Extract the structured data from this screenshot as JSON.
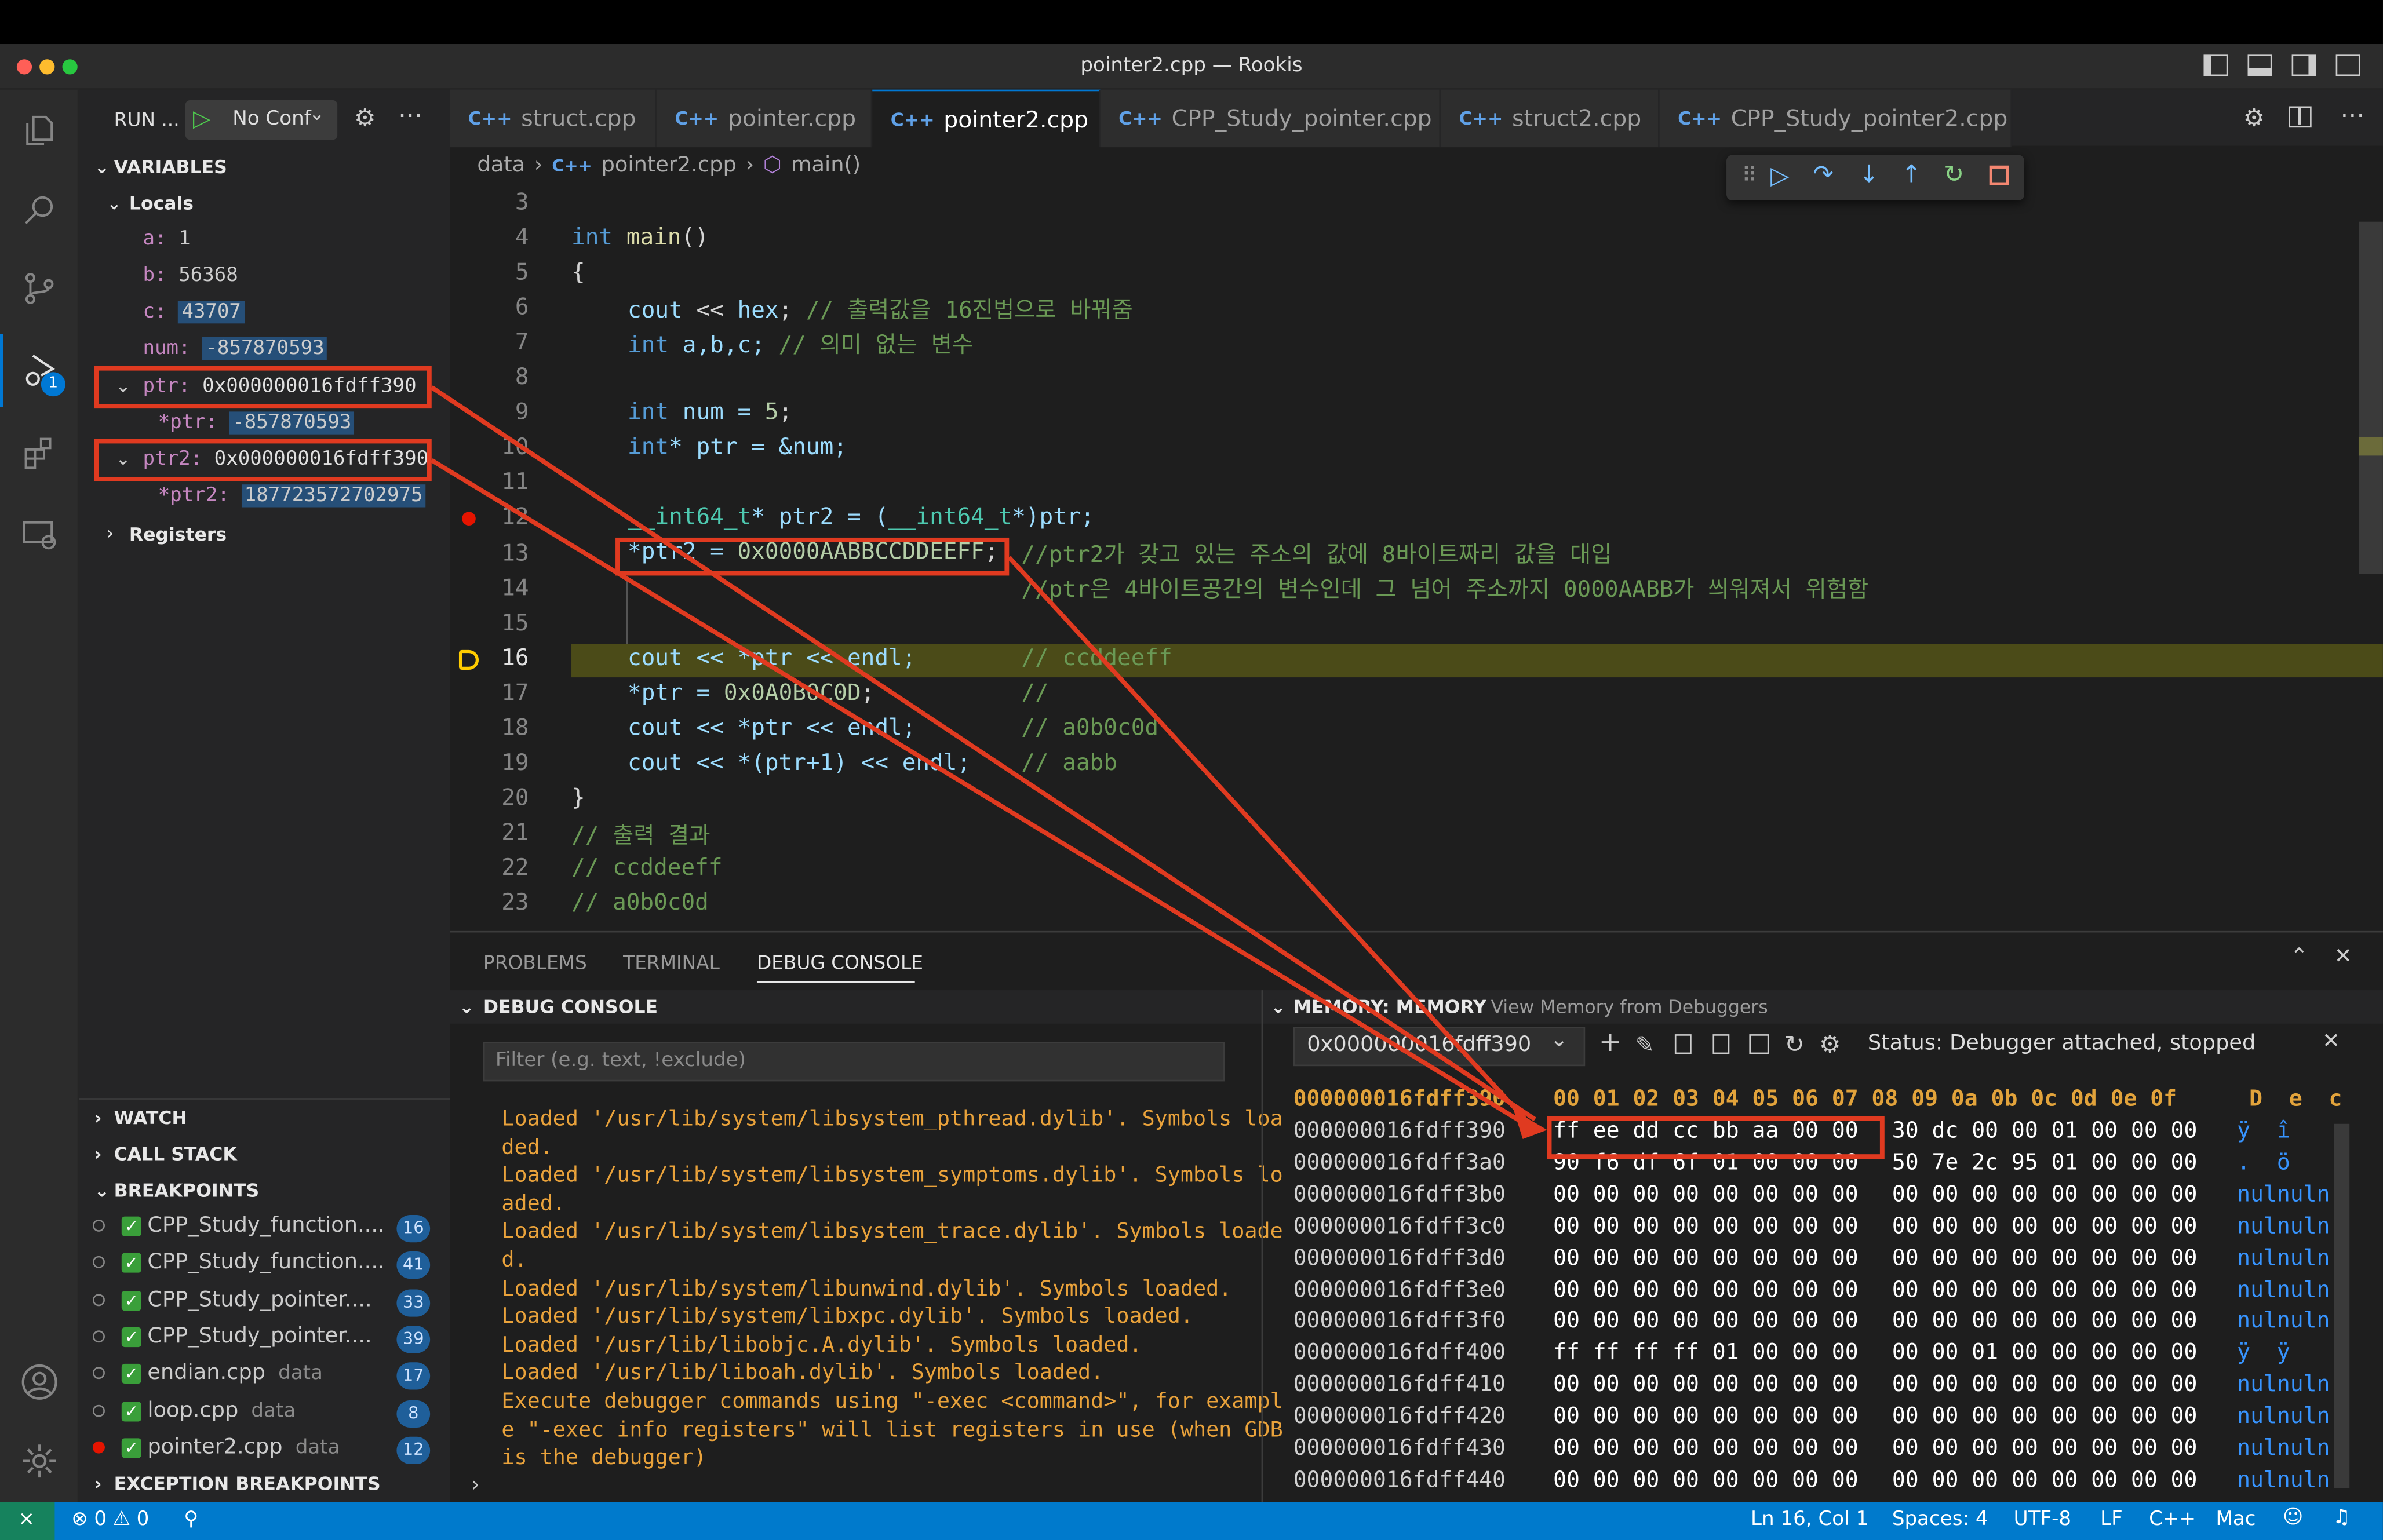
{
  "window": {
    "title": "pointer2.cpp — Rookis"
  },
  "run": {
    "label": "RUN ...",
    "config": "No Conf"
  },
  "variables": {
    "header": "VARIABLES",
    "locals": "Locals",
    "items": [
      {
        "name": "a:",
        "value": "1"
      },
      {
        "name": "b:",
        "value": "56368"
      },
      {
        "name": "c:",
        "value": "43707"
      },
      {
        "name": "num:",
        "value": "-857870593"
      },
      {
        "name": "ptr:",
        "value": "0x000000016fdff390"
      },
      {
        "name": "*ptr:",
        "value": "-857870593"
      },
      {
        "name": "ptr2:",
        "value": "0x000000016fdff390"
      },
      {
        "name": "*ptr2:",
        "value": "187723572702975"
      }
    ],
    "registers": "Registers"
  },
  "sections": {
    "watch": "WATCH",
    "callstack": "CALL STACK",
    "breakpoints": "BREAKPOINTS",
    "exception": "EXCEPTION BREAKPOINTS"
  },
  "breakpoints": [
    {
      "label": "CPP_Study_function....",
      "dir": "",
      "line": "16"
    },
    {
      "label": "CPP_Study_function....",
      "dir": "",
      "line": "41"
    },
    {
      "label": "CPP_Study_pointer....",
      "dir": "",
      "line": "33"
    },
    {
      "label": "CPP_Study_pointer....",
      "dir": "",
      "line": "39"
    },
    {
      "label": "endian.cpp",
      "dir": "data",
      "line": "17"
    },
    {
      "label": "loop.cpp",
      "dir": "data",
      "line": "8"
    },
    {
      "label": "pointer2.cpp",
      "dir": "data",
      "line": "12"
    }
  ],
  "tabs": [
    "struct.cpp",
    "pointer.cpp",
    "pointer2.cpp",
    "CPP_Study_pointer.cpp",
    "struct2.cpp",
    "CPP_Study_pointer2.cpp"
  ],
  "cppicon": "C++",
  "breadcrumb": {
    "folder": "data",
    "file": "pointer2.cpp",
    "symbol": "main()"
  },
  "code_lines": [
    "3",
    "4",
    "5",
    "6",
    "7",
    "8",
    "9",
    "10",
    "11",
    "12",
    "13",
    "14",
    "15",
    "16",
    "17",
    "18",
    "19",
    "20",
    "21",
    "22",
    "23"
  ],
  "code": {
    "l4a": "int",
    "l4b": " main",
    "l4c": "()",
    "l5": "{",
    "l6a": "cout",
    "l6b": " << ",
    "l6c": "hex",
    "l6d": "; ",
    "l6e": "// 출력값을 16진법으로 바꿔줌",
    "l7a": "int",
    "l7b": " a,b,c; ",
    "l7c": "// 의미 없는 변수",
    "l9a": "int",
    "l9b": " num = ",
    "l9c": "5",
    ";": ";",
    "l10a": "int",
    "l10b": "* ptr = &num;",
    "l12a": "__int64_t",
    "l12b": "* ptr2 = (",
    "l12c": "__int64_t",
    "l12d": "*)ptr;",
    "l13a": "*ptr2 = ",
    "l13b": "0x0000AABBCCDDEEFF",
    "l13c": "//ptr2가 갖고 있는 주소의 값에 8바이트짜리 값을 대입",
    "l14": "//ptr은 4바이트공간의 변수인데 그 넘어 주소까지 0000AABB가 씌워져서 위험함",
    "l16a": "cout << *ptr << endl;",
    "l16b": "// ccddeeff",
    "l17a": "*ptr = ",
    "l17b": "0x0A0B0C0D",
    "l17c": ";",
    "l17d": "//",
    "l18a": "cout << *ptr << endl;",
    "l18b": "// a0b0c0d",
    "l19a": "cout << *(ptr+1) << endl;",
    "l19b": "// aabb",
    "l20": "}",
    "l21": "// 출력 결과",
    "l22": "// ccddeeff",
    "l23": "// a0b0c0d"
  },
  "panel": {
    "tabs": [
      "PROBLEMS",
      "TERMINAL",
      "DEBUG CONSOLE"
    ],
    "debug_header": "DEBUG CONSOLE",
    "filter_placeholder": "Filter (e.g. text, !exclude)",
    "memory_header": "MEMORY: MEMORY",
    "memory_sub": "View Memory from Debuggers",
    "address": "0x000000016fdff390",
    "status": "Status: Debugger attached, stopped"
  },
  "console": [
    "Loaded '/usr/lib/system/libsystem_pthread.dylib'. Symbols loa",
    "ded.",
    "Loaded '/usr/lib/system/libsystem_symptoms.dylib'. Symbols lo",
    "aded.",
    "Loaded '/usr/lib/system/libsystem_trace.dylib'. Symbols loade",
    "d.",
    "Loaded '/usr/lib/system/libunwind.dylib'. Symbols loaded.",
    "Loaded '/usr/lib/system/libxpc.dylib'. Symbols loaded.",
    "Loaded '/usr/lib/libobjc.A.dylib'. Symbols loaded.",
    "Loaded '/usr/lib/liboah.dylib'. Symbols loaded.",
    "Execute debugger commands using \"-exec <command>\", for exampl",
    "e \"-exec info registers\" will list registers in use (when GDB",
    "is the debugger)"
  ],
  "memory": {
    "header_addr": "000000016fdff390",
    "header_bytes": "00 01 02 03 04 05 06 07 08 09 0a 0b 0c 0d 0e 0f",
    "header_ascii": "D  e  c",
    "rows": [
      {
        "addr": "000000016fdff390",
        "b1": "ff ee dd cc bb aa 00 00",
        "b2": "30 dc 00 00 01 00 00 00",
        "ascii": "ÿ  î"
      },
      {
        "addr": "000000016fdff3a0",
        "b1": "90 f6 df 6f 01 00 00 00",
        "b2": "50 7e 2c 95 01 00 00 00",
        "ascii": ".  ö"
      },
      {
        "addr": "000000016fdff3b0",
        "b1": "00 00 00 00 00 00 00 00",
        "b2": "00 00 00 00 00 00 00 00",
        "ascii": "nulnuln"
      },
      {
        "addr": "000000016fdff3c0",
        "b1": "00 00 00 00 00 00 00 00",
        "b2": "00 00 00 00 00 00 00 00",
        "ascii": "nulnuln"
      },
      {
        "addr": "000000016fdff3d0",
        "b1": "00 00 00 00 00 00 00 00",
        "b2": "00 00 00 00 00 00 00 00",
        "ascii": "nulnuln"
      },
      {
        "addr": "000000016fdff3e0",
        "b1": "00 00 00 00 00 00 00 00",
        "b2": "00 00 00 00 00 00 00 00",
        "ascii": "nulnuln"
      },
      {
        "addr": "000000016fdff3f0",
        "b1": "00 00 00 00 00 00 00 00",
        "b2": "00 00 00 00 00 00 00 00",
        "ascii": "nulnuln"
      },
      {
        "addr": "000000016fdff400",
        "b1": "ff ff ff ff 01 00 00 00",
        "b2": "00 00 01 00 00 00 00 00",
        "ascii": "ÿ  ÿ"
      },
      {
        "addr": "000000016fdff410",
        "b1": "00 00 00 00 00 00 00 00",
        "b2": "00 00 00 00 00 00 00 00",
        "ascii": "nulnuln"
      },
      {
        "addr": "000000016fdff420",
        "b1": "00 00 00 00 00 00 00 00",
        "b2": "00 00 00 00 00 00 00 00",
        "ascii": "nulnuln"
      },
      {
        "addr": "000000016fdff430",
        "b1": "00 00 00 00 00 00 00 00",
        "b2": "00 00 00 00 00 00 00 00",
        "ascii": "nulnuln"
      },
      {
        "addr": "000000016fdff440",
        "b1": "00 00 00 00 00 00 00 00",
        "b2": "00 00 00 00 00 00 00 00",
        "ascii": "nulnuln"
      }
    ]
  },
  "statusbar": {
    "errors": "0",
    "warnings": "0",
    "position": "Ln 16, Col 1",
    "spaces": "Spaces: 4",
    "encoding": "UTF-8",
    "eol": "LF",
    "lang": "C++",
    "platform": "Mac"
  },
  "debug_badge": "1",
  "colors": {
    "accent": "#007acc",
    "annotation": "#e03a20"
  }
}
